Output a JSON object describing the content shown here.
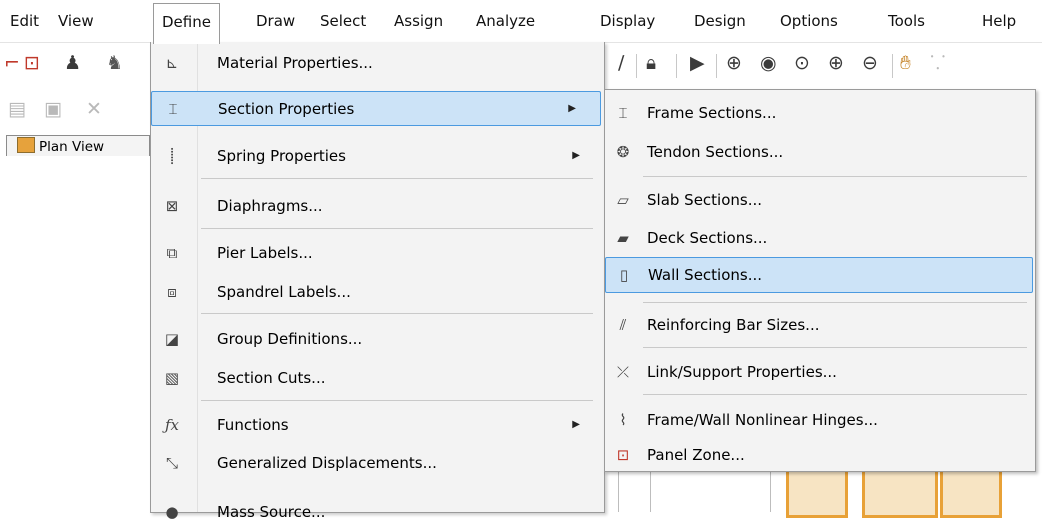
{
  "menubar": {
    "items": [
      "Edit",
      "View",
      "Define",
      "Draw",
      "Select",
      "Assign",
      "Analyze",
      "Display",
      "Design",
      "Options",
      "Tools",
      "Help"
    ]
  },
  "view_tab": {
    "label": "Plan View"
  },
  "define_menu": {
    "items": [
      {
        "label": "Material Properties...",
        "icon": "material-icon"
      },
      {
        "label": "Section Properties",
        "icon": "section-icon",
        "submenu": true,
        "highlighted": true
      },
      {
        "label": "Spring Properties",
        "icon": "spring-icon",
        "submenu": true
      },
      {
        "label": "Diaphragms...",
        "icon": "diaphragm-icon"
      },
      {
        "label": "Pier Labels...",
        "icon": "pier-icon"
      },
      {
        "label": "Spandrel Labels...",
        "icon": "spandrel-icon"
      },
      {
        "label": "Group Definitions...",
        "icon": "group-icon"
      },
      {
        "label": "Section Cuts...",
        "icon": "section-cut-icon"
      },
      {
        "label": "Functions",
        "icon": "function-icon",
        "submenu": true
      },
      {
        "label": "Generalized Displacements...",
        "icon": "displacement-icon"
      },
      {
        "label": "Mass Source...",
        "icon": "mass-icon"
      }
    ]
  },
  "section_submenu": {
    "items": [
      {
        "label": "Frame Sections...",
        "icon": "frame-section-icon"
      },
      {
        "label": "Tendon Sections...",
        "icon": "tendon-icon"
      },
      {
        "label": "Slab Sections...",
        "icon": "slab-icon"
      },
      {
        "label": "Deck Sections...",
        "icon": "deck-icon"
      },
      {
        "label": "Wall Sections...",
        "icon": "wall-icon",
        "highlighted": true
      },
      {
        "label": "Reinforcing Bar Sizes...",
        "icon": "rebar-icon"
      },
      {
        "label": "Link/Support Properties...",
        "icon": "link-icon"
      },
      {
        "label": "Frame/Wall Nonlinear Hinges...",
        "icon": "hinge-icon"
      },
      {
        "label": "Panel Zone...",
        "icon": "panel-zone-icon"
      }
    ]
  },
  "colors": {
    "highlight_bg": "#cce3f7",
    "highlight_border": "#4b9ae0",
    "accent_orange": "#e8a137"
  }
}
